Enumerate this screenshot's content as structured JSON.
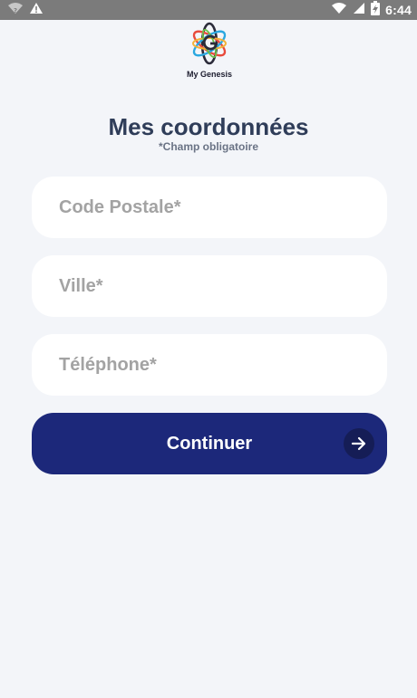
{
  "status_bar": {
    "time": "6:44",
    "icons": [
      "wifi-question-icon",
      "warning-icon",
      "wifi-icon",
      "signal-icon",
      "battery-charging-icon"
    ]
  },
  "logo": {
    "label": "My Genesis"
  },
  "header": {
    "title": "Mes coordonnées",
    "subtitle": "*Champ obligatoire"
  },
  "form": {
    "postal_code_placeholder": "Code Postale*",
    "postal_code_value": "",
    "city_placeholder": "Ville*",
    "city_value": "",
    "phone_placeholder": "Téléphone*",
    "phone_value": ""
  },
  "actions": {
    "continue_label": "Continuer"
  },
  "colors": {
    "background": "#f3f5f9",
    "primary_button": "#1c287a",
    "title_text": "#2f3d59",
    "placeholder_text": "#a3a3a3"
  }
}
